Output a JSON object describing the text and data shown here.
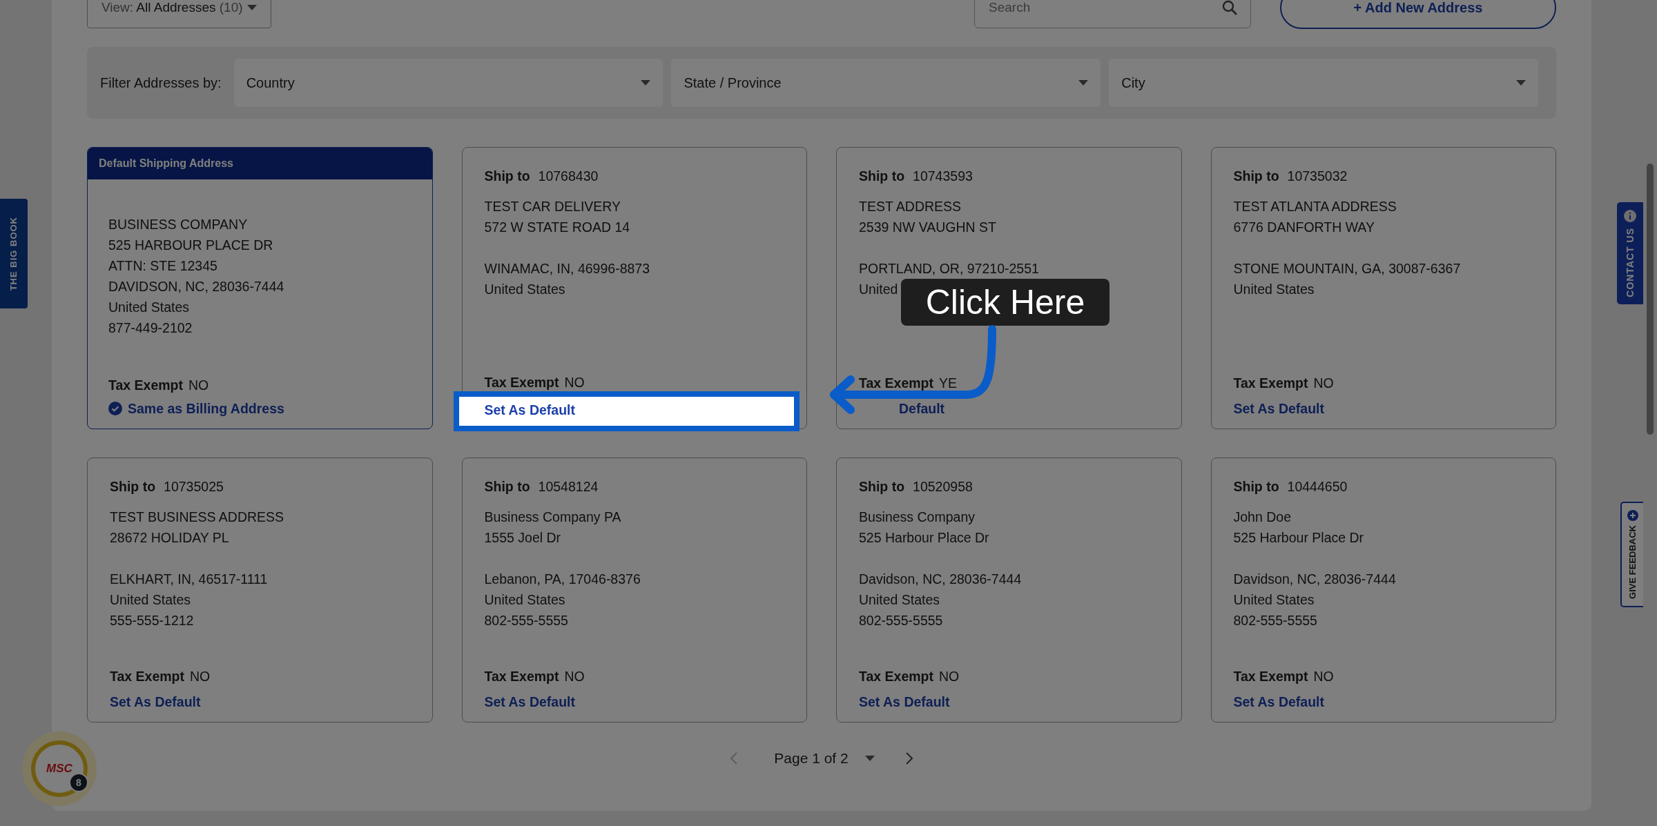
{
  "toolbar": {
    "view_select": {
      "prefix": "View:",
      "value": "All Addresses",
      "count": "(10)"
    },
    "search": {
      "placeholder": "Search"
    },
    "add_button": "+ Add New Address"
  },
  "filter": {
    "label": "Filter Addresses by:",
    "selects": [
      {
        "placeholder": "Country"
      },
      {
        "placeholder": "State / Province"
      },
      {
        "placeholder": "City"
      }
    ]
  },
  "cards": [
    {
      "kind": "default",
      "header": "Default Shipping Address",
      "address_blocks": [
        [
          "BUSINESS COMPANY",
          "525 HARBOUR PLACE DR",
          "ATTN: STE 12345",
          "DAVIDSON, NC, 28036-7444",
          "United States",
          "877-449-2102"
        ]
      ],
      "tax_label": "Tax Exempt",
      "tax_value": "NO",
      "billing_note": "Same as Billing Address"
    },
    {
      "kind": "ship_to",
      "ship_label": "Ship to",
      "number": "10768430",
      "address_blocks": [
        [
          "TEST CAR DELIVERY",
          "572 W STATE ROAD 14"
        ],
        [
          "WINAMAC, IN, 46996-8873",
          "United States"
        ]
      ],
      "tax_label": "Tax Exempt",
      "tax_value": "NO",
      "action": {
        "text": "Set As Default",
        "highlighted": true
      }
    },
    {
      "kind": "ship_to",
      "ship_label": "Ship to",
      "number": "10743593",
      "address_blocks": [
        [
          "TEST ADDRESS",
          "2539 NW VAUGHN ST"
        ],
        [
          "PORTLAND, OR, 97210-2551",
          "United"
        ]
      ],
      "tax_label": "Tax Exempt",
      "tax_value": "YE",
      "action": {
        "text": "Default",
        "highlighted": false,
        "covered_prefix": true
      }
    },
    {
      "kind": "ship_to",
      "ship_label": "Ship to",
      "number": "10735032",
      "address_blocks": [
        [
          "TEST ATLANTA ADDRESS",
          "6776 DANFORTH WAY"
        ],
        [
          "STONE MOUNTAIN, GA, 30087-6367",
          "United States"
        ]
      ],
      "tax_label": "Tax Exempt",
      "tax_value": "NO",
      "action": {
        "text": "Set As Default",
        "highlighted": false
      }
    },
    {
      "kind": "ship_to",
      "ship_label": "Ship to",
      "number": "10735025",
      "address_blocks": [
        [
          "TEST BUSINESS ADDRESS",
          "28672 HOLIDAY PL"
        ],
        [
          "ELKHART, IN, 46517-1111",
          "United States",
          "555-555-1212"
        ]
      ],
      "tax_label": "Tax Exempt",
      "tax_value": "NO",
      "action": {
        "text": "Set As Default",
        "highlighted": false
      }
    },
    {
      "kind": "ship_to",
      "ship_label": "Ship to",
      "number": "10548124",
      "address_blocks": [
        [
          "Business Company PA",
          "1555 Joel Dr"
        ],
        [
          "Lebanon, PA, 17046-8376",
          "United States",
          "802-555-5555"
        ]
      ],
      "tax_label": "Tax Exempt",
      "tax_value": "NO",
      "action": {
        "text": "Set As Default",
        "highlighted": false
      }
    },
    {
      "kind": "ship_to",
      "ship_label": "Ship to",
      "number": "10520958",
      "address_blocks": [
        [
          "Business Company",
          "525 Harbour Place Dr"
        ],
        [
          "Davidson, NC, 28036-7444",
          "United States",
          "802-555-5555"
        ]
      ],
      "tax_label": "Tax Exempt",
      "tax_value": "NO",
      "action": {
        "text": "Set As Default",
        "highlighted": false
      }
    },
    {
      "kind": "ship_to",
      "ship_label": "Ship to",
      "number": "10444650",
      "address_blocks": [
        [
          "John Doe",
          "525 Harbour Place Dr"
        ],
        [
          "Davidson, NC, 28036-7444",
          "United States",
          "802-555-5555"
        ]
      ],
      "tax_label": "Tax Exempt",
      "tax_value": "NO",
      "action": {
        "text": "Set As Default",
        "highlighted": false
      }
    }
  ],
  "pagination": {
    "text": "Page 1 of 2",
    "prev_disabled": true,
    "next_disabled": false
  },
  "side_tabs": {
    "left": "THE BIG BOOK",
    "contact": "CONTACT US",
    "feedback": "GIVE FEEDBACK"
  },
  "chat_badge": {
    "logo": "MSC",
    "count": "8"
  },
  "callout": {
    "text": "Click Here"
  }
}
